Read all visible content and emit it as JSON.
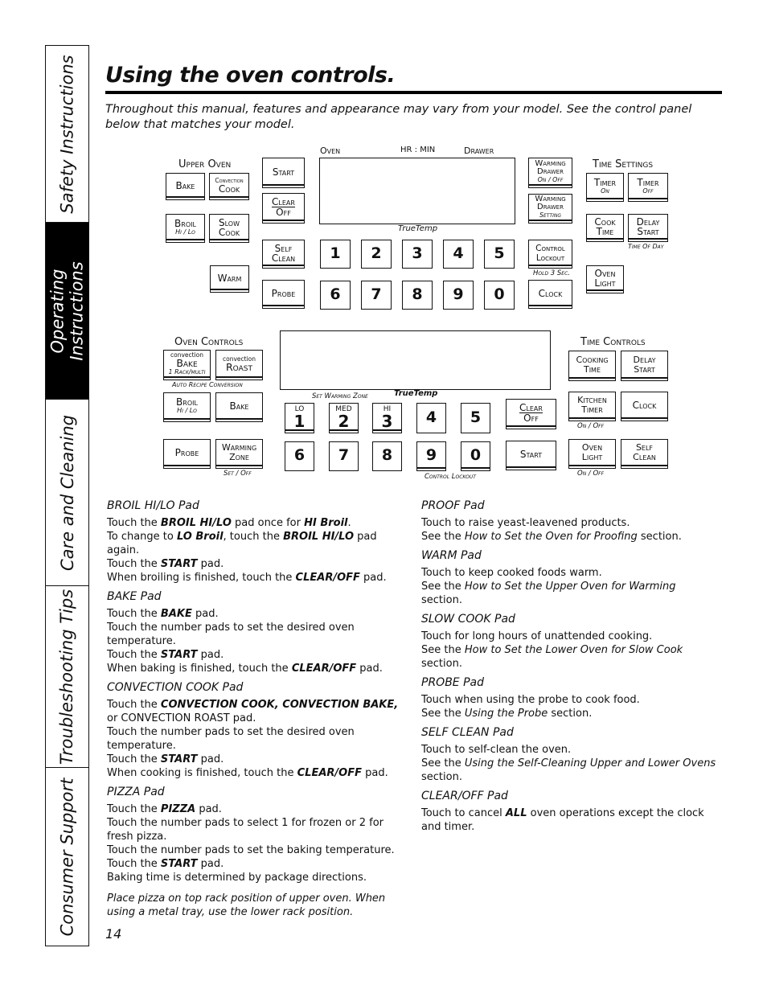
{
  "side_tabs": [
    {
      "label": "Safety Instructions",
      "active": false
    },
    {
      "label": "Operating Instructions",
      "active": true
    },
    {
      "label": "Care and Cleaning",
      "active": false
    },
    {
      "label": "Troubleshooting Tips",
      "active": false
    },
    {
      "label": "Consumer Support",
      "active": false
    }
  ],
  "page": {
    "title": "Using the oven controls.",
    "intro": "Throughout this manual, features and appearance may vary from your model. See the control panel below that matches your model.",
    "page_number": "14"
  },
  "panel1": {
    "upper_oven_label": "Upper Oven",
    "display_labels": {
      "oven": "Oven",
      "hr_min": "HR : MIN",
      "drawer": "Drawer",
      "truetemp": "TrueTemp"
    },
    "pads": {
      "bake": "Bake",
      "convection_cook_top": "Convection",
      "convection_cook": "Cook",
      "broil": "Broil",
      "broil_sub": "Hi / Lo",
      "slow_cook_1": "Slow",
      "slow_cook_2": "Cook",
      "warm": "Warm",
      "start": "Start",
      "clear": "Clear",
      "off": "Off",
      "self": "Self",
      "clean": "Clean",
      "probe": "Probe",
      "warming_drawer_1": "Warming",
      "warming_drawer_2": "Drawer",
      "warming_drawer_onoff": "On / Off",
      "warming_drawer_setting": "Setting",
      "control": "Control",
      "lockout": "Lockout",
      "hold_3_sec": "Hold 3 Sec.",
      "clock": "Clock",
      "time_settings_label": "Time Settings",
      "timer": "Timer",
      "timer_on": "On",
      "timer_off": "Off",
      "cook": "Cook",
      "time": "Time",
      "delay": "Delay",
      "start2": "Start",
      "time_of_day": "Time Of Day",
      "oven": "Oven",
      "light": "Light"
    },
    "numbers": [
      "1",
      "2",
      "3",
      "4",
      "5",
      "6",
      "7",
      "8",
      "9",
      "0"
    ]
  },
  "panel2": {
    "oven_controls_label": "Oven Controls",
    "time_controls_label": "Time Controls",
    "truetemp": "TrueTemp",
    "set_warming_zone": "Set Warming Zone",
    "control_lockout": "Control Lockout",
    "auto_recipe": "Auto Recipe Conversion",
    "pads": {
      "convection": "convection",
      "bake": "Bake",
      "rack_multi": "1 Rack/multi",
      "roast": "Roast",
      "broil": "Broil",
      "broil_sub": "Hi / Lo",
      "bake2": "Bake",
      "probe": "Probe",
      "warming": "Warming",
      "zone": "Zone",
      "set_off": "Set / Off",
      "clear": "Clear",
      "off": "Off",
      "start": "Start",
      "cooking": "Cooking",
      "time": "Time",
      "delay": "Delay",
      "start2": "Start",
      "kitchen": "Kitchen",
      "timer": "Timer",
      "on_off": "On / Off",
      "clock": "Clock",
      "oven": "Oven",
      "light": "Light",
      "self": "Self",
      "clean": "Clean"
    },
    "number_tops": [
      "LO",
      "MED",
      "HI"
    ],
    "numbers": [
      "1",
      "2",
      "3",
      "4",
      "5",
      "6",
      "7",
      "8",
      "9",
      "0"
    ]
  },
  "descriptions_left": [
    {
      "heading": "BROIL HI/LO Pad",
      "lines": [
        [
          "Touch the ",
          {
            "b": "BROIL HI/LO"
          },
          " pad once for ",
          {
            "b": "HI Broil"
          },
          "."
        ],
        [
          "To change to ",
          {
            "b": "LO Broil"
          },
          ", touch the ",
          {
            "b": "BROIL HI/LO"
          },
          " pad again."
        ],
        [
          "Touch the ",
          {
            "b": "START"
          },
          " pad."
        ],
        [
          "When broiling is finished, touch the ",
          {
            "b": "CLEAR/OFF"
          },
          " pad."
        ]
      ]
    },
    {
      "heading": "BAKE Pad",
      "lines": [
        [
          "Touch the ",
          {
            "b": "BAKE"
          },
          " pad."
        ],
        [
          "Touch the number pads to set the desired oven temperature."
        ],
        [
          "Touch the ",
          {
            "b": "START"
          },
          " pad."
        ],
        [
          "When baking is finished, touch the ",
          {
            "b": "CLEAR/OFF"
          },
          " pad."
        ]
      ]
    },
    {
      "heading": "CONVECTION COOK Pad",
      "lines": [
        [
          "Touch the ",
          {
            "b": "CONVECTION COOK, CONVECTION BAKE,"
          },
          " or CONVECTION ROAST pad."
        ],
        [
          "Touch the number pads to set the desired oven temperature."
        ],
        [
          "Touch the ",
          {
            "b": "START"
          },
          " pad."
        ],
        [
          "When cooking is finished, touch the ",
          {
            "b": "CLEAR/OFF"
          },
          " pad."
        ]
      ]
    },
    {
      "heading": "PIZZA Pad",
      "lines": [
        [
          "Touch the ",
          {
            "b": "PIZZA"
          },
          " pad."
        ],
        [
          "Touch the number pads to select 1 for frozen or 2 for fresh pizza."
        ],
        [
          "Touch the number pads to set the baking temperature."
        ],
        [
          "Touch the ",
          {
            "b": "START"
          },
          " pad."
        ],
        [
          "Baking time is determined by package directions."
        ]
      ],
      "note": "Place pizza on top rack position of upper oven. When using a metal tray, use the lower rack position."
    }
  ],
  "descriptions_right": [
    {
      "heading": "PROOF Pad",
      "lines": [
        [
          "Touch to raise yeast-leavened products."
        ],
        [
          "See the ",
          {
            "i": "How to Set the Oven for Proofing"
          },
          " section."
        ]
      ]
    },
    {
      "heading": "WARM Pad",
      "lines": [
        [
          "Touch to keep cooked foods warm."
        ],
        [
          "See the ",
          {
            "i": "How to Set the Upper Oven for Warming"
          },
          " section."
        ]
      ]
    },
    {
      "heading": "SLOW COOK Pad",
      "lines": [
        [
          "Touch for long hours of unattended cooking."
        ],
        [
          "See the ",
          {
            "i": "How to Set the Lower Oven for Slow Cook"
          },
          " section."
        ]
      ]
    },
    {
      "heading": "PROBE Pad",
      "lines": [
        [
          "Touch when using the probe to cook food."
        ],
        [
          "See the ",
          {
            "i": "Using the Probe"
          },
          " section."
        ]
      ]
    },
    {
      "heading": "SELF CLEAN Pad",
      "lines": [
        [
          "Touch to self-clean the oven."
        ],
        [
          "See the ",
          {
            "i": "Using the Self-Cleaning Upper and Lower Ovens"
          },
          " section."
        ]
      ]
    },
    {
      "heading": "CLEAR/OFF Pad",
      "lines": [
        [
          "Touch to cancel ",
          {
            "b": "ALL"
          },
          " oven operations except the clock and timer."
        ]
      ]
    }
  ]
}
